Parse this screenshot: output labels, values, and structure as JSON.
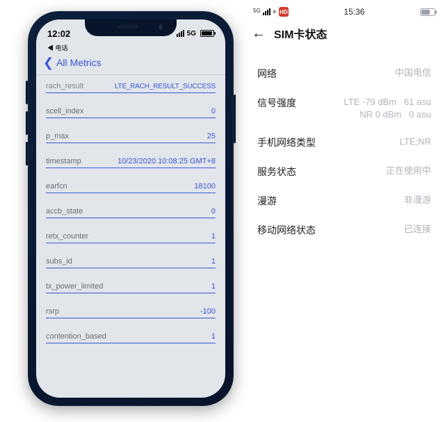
{
  "left": {
    "statusbar": {
      "time": "12:02",
      "signal": "5G"
    },
    "carrier_back": "◀ 电话",
    "nav_title": "All Metrics",
    "metrics": [
      {
        "k": "rach_result",
        "v": "LTE_RACH_RESULT_SUCCESS"
      },
      {
        "k": "scell_index",
        "v": "0"
      },
      {
        "k": "p_max",
        "v": "25"
      },
      {
        "k": "timestamp",
        "v": "10/23/2020 10:08:25 GMT+8"
      },
      {
        "k": "earfcn",
        "v": "18100"
      },
      {
        "k": "accb_state",
        "v": "0"
      },
      {
        "k": "retx_counter",
        "v": "1"
      },
      {
        "k": "subs_id",
        "v": "1"
      },
      {
        "k": "tx_power_limited",
        "v": "1"
      },
      {
        "k": "rsrp",
        "v": "-100"
      },
      {
        "k": "contention_based",
        "v": "1"
      }
    ]
  },
  "right": {
    "statusbar": {
      "indicator5g": "5G",
      "badge": "HD",
      "time": "15:36"
    },
    "title": "SIM卡状态",
    "rows": [
      {
        "label": "网络",
        "value": "中国电信"
      },
      {
        "label": "信号强度",
        "value": "LTE -79 dBm   61 asu\nNR 0 dBm   0 asu"
      },
      {
        "label": "手机网络类型",
        "value": "LTE;NR"
      },
      {
        "label": "服务状态",
        "value": "正在使用中"
      },
      {
        "label": "漫游",
        "value": "非漫游"
      },
      {
        "label": "移动网络状态",
        "value": "已连接"
      }
    ]
  }
}
